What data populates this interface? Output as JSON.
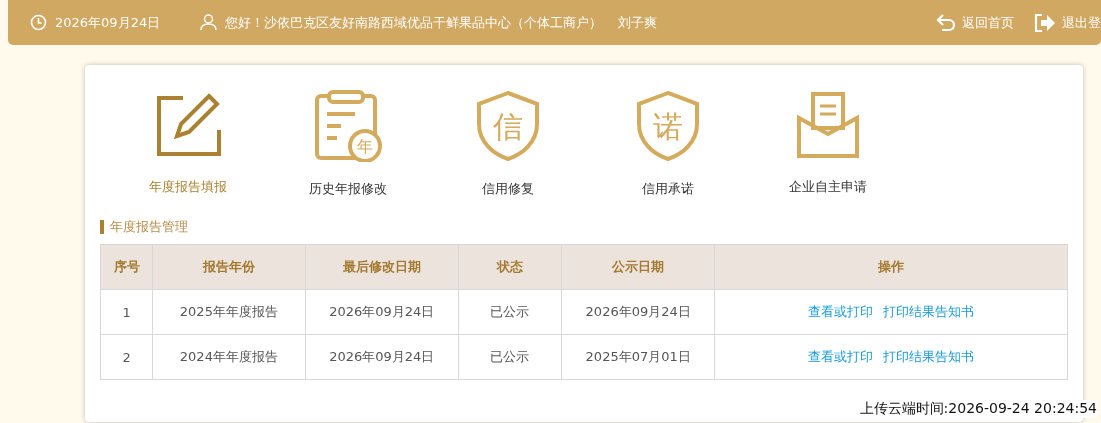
{
  "header": {
    "date": "2026年09月24日",
    "greeting": "您好！沙依巴克区友好南路西域优品干鲜果品中心（个体工商户）",
    "user": "刘子爽",
    "links": [
      {
        "kind": "home",
        "label": "返回首页"
      },
      {
        "kind": "logout",
        "label": "退出登"
      }
    ]
  },
  "menu": [
    {
      "kind": "edit",
      "label": "年度报告填报",
      "selected": true
    },
    {
      "kind": "history",
      "label": "历史年报修改",
      "selected": false,
      "badge": "年"
    },
    {
      "kind": "shield",
      "label": "信用修复",
      "selected": false,
      "badge": "信"
    },
    {
      "kind": "shield",
      "label": "信用承诺",
      "selected": false,
      "badge": "诺"
    },
    {
      "kind": "envelope",
      "label": "企业自主申请",
      "selected": false
    }
  ],
  "section_title": "年度报告管理",
  "table": {
    "columns": [
      "序号",
      "报告年份",
      "最后修改日期",
      "状态",
      "公示日期",
      "操作"
    ],
    "rows": [
      {
        "cells": [
          "1",
          "2025年年度报告",
          "2026年09月24日",
          "已公示",
          "2026年09月24日"
        ],
        "actions": [
          "查看或打印",
          "打印结果告知书"
        ]
      },
      {
        "cells": [
          "2",
          "2024年年度报告",
          "2026年09月24日",
          "已公示",
          "2025年07月01日"
        ],
        "actions": [
          "查看或打印",
          "打印结果告知书"
        ]
      }
    ]
  },
  "upload_time": "上传云端时间:2026-09-24 20:24:54"
}
